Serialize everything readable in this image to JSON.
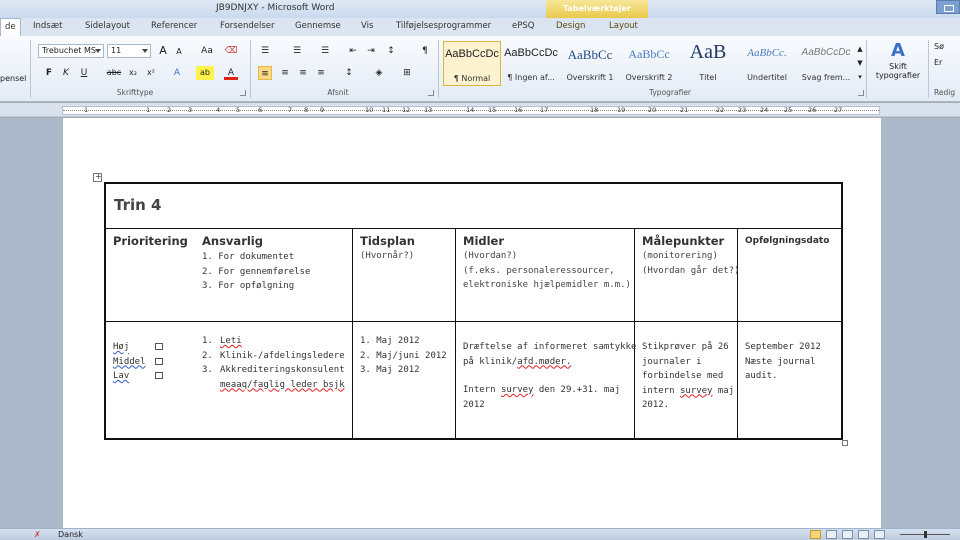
{
  "window": {
    "title": "JB9DNJXY - Microsoft Word",
    "context_tab_group": "Tabelværktøjer"
  },
  "tabs": [
    {
      "label": "de"
    },
    {
      "label": "Indsæt"
    },
    {
      "label": "Sidelayout"
    },
    {
      "label": "Referencer"
    },
    {
      "label": "Forsendelser"
    },
    {
      "label": "Gennemse"
    },
    {
      "label": "Vis"
    },
    {
      "label": "Tilføjelsesprogrammer"
    },
    {
      "label": "ePSQ"
    },
    {
      "label": "Design"
    },
    {
      "label": "Layout"
    }
  ],
  "ribbon": {
    "clipboard_cut_label": "pensel",
    "font": {
      "name": "Trebuchet MS",
      "size": "11",
      "group_label": "Skrifttype",
      "bold": "F",
      "italic": "K",
      "underline": "U",
      "strike": "abc",
      "subscript": "x₂",
      "superscript": "x²",
      "grow": "A",
      "shrink": "A",
      "case": "Aa",
      "text_effects": "A",
      "highlight": "ab",
      "font_color": "A"
    },
    "paragraph": {
      "group_label": "Afsnit",
      "pilcrow": "¶"
    },
    "styles": {
      "group_label": "Typografier",
      "items": [
        {
          "sample": "AaBbCcDc",
          "name": "¶ Normal"
        },
        {
          "sample": "AaBbCcDc",
          "name": "¶ Ingen af..."
        },
        {
          "sample": "AaBbCc",
          "name": "Overskrift 1"
        },
        {
          "sample": "AaBbCc",
          "name": "Overskrift 2"
        },
        {
          "sample": "AaB",
          "name": "Titel"
        },
        {
          "sample": "AaBbCc.",
          "name": "Undertitel"
        },
        {
          "sample": "AaBbCcDc",
          "name": "Svag frem..."
        }
      ],
      "change_styles_label_1": "Skift",
      "change_styles_label_2": "typografier"
    },
    "editing": {
      "label_find": "Sø",
      "label_replace": "Er",
      "group_label": "Redig"
    }
  },
  "ruler": {
    "numbers": [
      "1",
      "1",
      "2",
      "3",
      "4",
      "5",
      "6",
      "7",
      "8",
      "9",
      "10",
      "11",
      "12",
      "13",
      "14",
      "15",
      "16",
      "17",
      "18",
      "19",
      "20",
      "21",
      "22",
      "23",
      "24",
      "25",
      "26",
      "27"
    ]
  },
  "document": {
    "heading": "Trin 4",
    "headers": {
      "prioritering": "Prioritering",
      "ansvarlig": "Ansvarlig",
      "tidsplan": "Tidsplan",
      "midler": "Midler",
      "maalepunkter": "Målepunkter",
      "opfoelgningsdato": "Opfølgningsdato"
    },
    "ansvarlig_list": [
      "1.  For dokumentet",
      "2.  For gennemførelse",
      "3.  For opfølgning"
    ],
    "tidsplan_sub": "(Hvornår?)",
    "midler_sub_1": "(Hvordan?)",
    "midler_sub_2": "(f.eks. personaleressourcer,",
    "midler_sub_3": "elektroniske hjælpemidler m.m.)",
    "maalepunkter_sub_1": "(monitorering)",
    "maalepunkter_sub_2": "(Hvordan går det?)",
    "prioritet": {
      "hoej": "Høj",
      "middel": "Middel",
      "lav": "Lav"
    },
    "ansvarlig_rows": {
      "r1_n": "1.",
      "r1": "Leti",
      "r2_n": "2.",
      "r2": "Klinik-/afdelingsledere",
      "r3_n": "3.",
      "r3a": "Akkrediteringskonsulent",
      "r3b": "meaaq/faglig leder bsjk"
    },
    "tidsplan_rows": [
      "1.  Maj 2012",
      "2.  Maj/juni 2012",
      "3.  Maj 2012"
    ],
    "midler_body_1a": "Dræftelse af informeret samtykke",
    "midler_body_1b": "på klinik/",
    "midler_body_1c": "afd.møder.",
    "midler_body_2a": "Intern ",
    "midler_body_2b": "survey",
    "midler_body_2c": " den 29.+31. maj",
    "midler_body_2d": "2012",
    "maalepunkter_body_1": "Stikprøver på 26",
    "maalepunkter_body_2": "journaler i",
    "maalepunkter_body_3": "forbindelse med",
    "maalepunkter_body_4a": "intern ",
    "maalepunkter_body_4b": "survey",
    "maalepunkter_body_4c": " maj",
    "maalepunkter_body_5": "2012.",
    "opf_body_1": "September 2012",
    "opf_body_2": "Næste journal",
    "opf_body_3": "audit."
  },
  "statusbar": {
    "language": "Dansk"
  }
}
